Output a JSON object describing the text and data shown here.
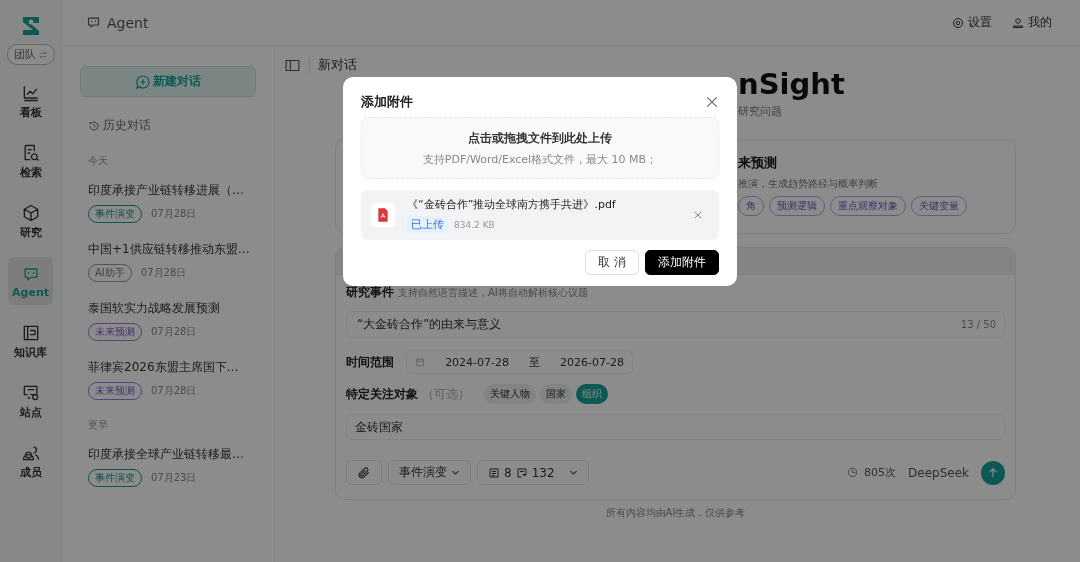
{
  "nav_rail": {
    "team_switch": {
      "label": "团队"
    },
    "items": [
      {
        "label": "看板",
        "selected": false
      },
      {
        "label": "检索",
        "selected": false
      },
      {
        "label": "研究",
        "selected": false
      },
      {
        "label": "Agent",
        "selected": true
      },
      {
        "label": "知识库",
        "selected": false
      },
      {
        "label": "站点",
        "selected": false
      },
      {
        "label": "成员",
        "selected": false
      }
    ]
  },
  "header": {
    "title": "Agent",
    "actions": [
      {
        "label": "设置"
      },
      {
        "label": "我的"
      }
    ]
  },
  "history": {
    "new_chat": "新建对话",
    "title": "历史对话",
    "groups": [
      {
        "label": "今天",
        "items": [
          {
            "title": "印度承接产业链转移进展（…",
            "tag": {
              "label": "事件演变",
              "kind": "event"
            },
            "date": "07月28日"
          },
          {
            "title": "中国+1供应链转移推动东盟…",
            "tag": {
              "label": "AI助手",
              "kind": "assistant"
            },
            "date": "07月28日"
          },
          {
            "title": "泰国软实力战略发展预测",
            "tag": {
              "label": "未来预测",
              "kind": "forecast"
            },
            "date": "07月28日"
          },
          {
            "title": "菲律宾2026东盟主席国下…",
            "tag": {
              "label": "未来预测",
              "kind": "forecast"
            },
            "date": "07月28日"
          }
        ]
      },
      {
        "label": "更早",
        "items": [
          {
            "title": "印度承接全球产业链转移最…",
            "tag": {
              "label": "事件演变",
              "kind": "event"
            },
            "date": "07月23日"
          }
        ]
      }
    ]
  },
  "main": {
    "page_title": "新对话",
    "hero": {
      "title_fragment": "nSight",
      "subtitle_fragment": "研究问题"
    },
    "mode_card": {
      "title_fragment": "来预测",
      "description_fragment": "推演，生成趋势路径与概率判断",
      "tags": [
        "角",
        "预测逻辑",
        "重点观察对象",
        "关键变量"
      ]
    },
    "form": {
      "event": {
        "label": "研究事件",
        "hint": "支持自然语言描述，AI将自动解析核心议题",
        "value": "“大金砖合作”的由来与意义",
        "counter": "13 / 50"
      },
      "time_range": {
        "label": "时间范围",
        "start": "2024-07-28",
        "separator": "至",
        "end": "2026-07-28"
      },
      "focus": {
        "label": "特定关注对象",
        "optional": "（可选）",
        "chips": [
          {
            "label": "关键人物",
            "selected": false
          },
          {
            "label": "国家",
            "selected": false
          },
          {
            "label": "组织",
            "selected": true
          }
        ],
        "value": "金砖国家"
      },
      "toolbar": {
        "mode": "事件演变",
        "count_a": "8",
        "count_b": "132",
        "usage": "805次",
        "model": "DeepSeek"
      }
    },
    "footer_note": "所有内容均由AI生成，仅供参考"
  },
  "dialog": {
    "title": "添加附件",
    "dropzone": {
      "title": "点击或拖拽文件到此处上传",
      "hint": "支持PDF/Word/Excel格式文件，最大 10 MB；"
    },
    "file": {
      "name": "《“金砖合作”推动全球南方携手共进》.pdf",
      "status": "已上传",
      "size": "834.2 KB"
    },
    "buttons": [
      {
        "label": "取 消",
        "kind": "secondary"
      },
      {
        "label": "添加附件",
        "kind": "primary"
      }
    ]
  }
}
